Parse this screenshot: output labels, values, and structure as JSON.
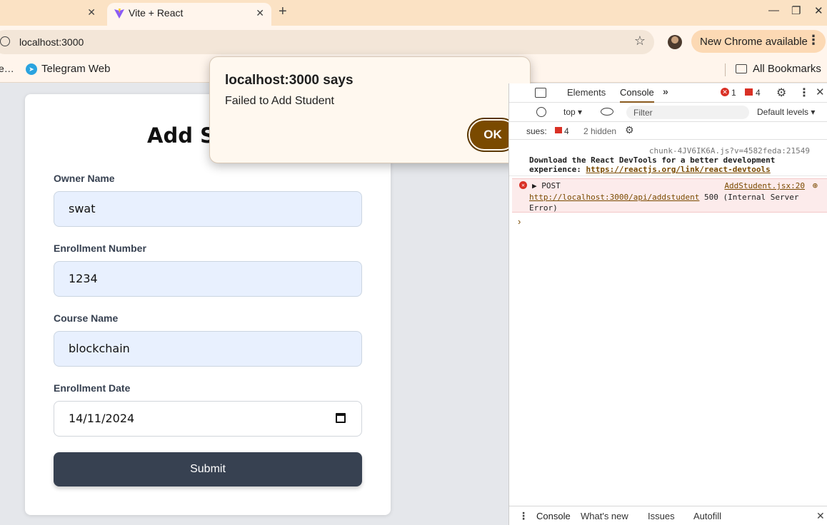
{
  "browser": {
    "tab_title": "Vite + React",
    "url": "localhost:3000",
    "update_label": "New Chrome available",
    "bookmarks": {
      "truncated": "e…",
      "telegram": "Telegram Web",
      "all": "All Bookmarks"
    }
  },
  "form": {
    "heading": "Add Stude",
    "fields": [
      {
        "label": "Owner Name",
        "value": "swat"
      },
      {
        "label": "Enrollment Number",
        "value": "1234"
      },
      {
        "label": "Course Name",
        "value": "blockchain"
      },
      {
        "label": "Enrollment Date",
        "value": "14/11/2024"
      }
    ],
    "submit_label": "Submit"
  },
  "alert": {
    "title": "localhost:3000 says",
    "message": "Failed to Add Student",
    "ok_label": "OK"
  },
  "devtools": {
    "tabs": {
      "elements": "Elements",
      "console": "Console"
    },
    "error_count": "1",
    "warning_count": "4",
    "context": "top ▾",
    "filter_placeholder": "Filter",
    "levels": "Default levels ▾",
    "issues_label": "sues:",
    "issues_count": "4",
    "hidden_label": "2 hidden",
    "log1": {
      "source": "chunk-4JV6IK6A.js?v=4582feda:21549",
      "text": "Download the React DevTools for a better development experience: ",
      "link": "https://reactjs.org/link/react-devtools"
    },
    "log2": {
      "method": "▶ POST",
      "source": "AddStudent.jsx:20",
      "url": "http://localhost:3000/api/addstudent",
      "message": " 500 (Internal Server Error)"
    },
    "prompt": "›",
    "drawer_tabs": {
      "console": "Console",
      "whats_new": "What's new",
      "issues": "Issues",
      "autofill": "Autofill"
    }
  },
  "colors": {
    "accent": "#7a4a00",
    "tabstrip": "#fbe2c4",
    "error": "#d93025",
    "submit_bg": "#374151"
  },
  "icons": [
    "vite-favicon",
    "close-icon",
    "plus-icon",
    "minimize-icon",
    "restore-icon",
    "info-icon",
    "star-icon",
    "avatar",
    "kebab-icon",
    "telegram-icon",
    "folder-icon",
    "device-toolbar-icon",
    "chevron-double-right-icon",
    "gear-icon",
    "clear-console-icon",
    "eye-icon",
    "filter-icon",
    "calendar-icon",
    "error-icon",
    "warning-flag-icon"
  ]
}
